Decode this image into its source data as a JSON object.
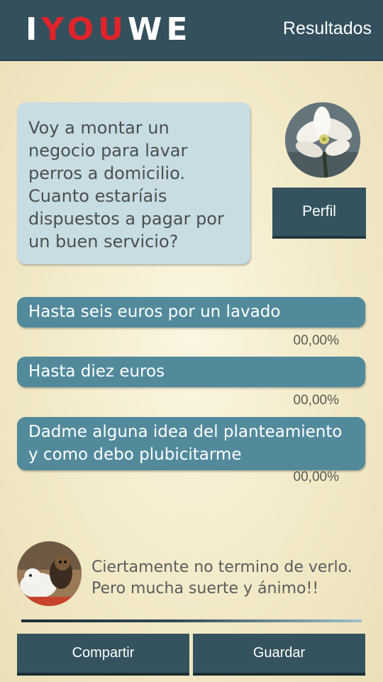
{
  "header": {
    "logo_part1": "I",
    "logo_part2": "YOU",
    "logo_part3": "WE",
    "results_label": "Resultados"
  },
  "question": {
    "text": "Voy a montar un negocio para lavar perros a domicilio. Cuanto estaríais dispuestos a pagar por un buen servicio?"
  },
  "profile": {
    "avatar_icon": "flower-avatar",
    "button_label": "Perfil"
  },
  "options": [
    {
      "label": "Hasta seis euros por un lavado",
      "percent": "00,00%"
    },
    {
      "label": "Hasta diez euros",
      "percent": "00,00%"
    },
    {
      "label": "Dadme alguna idea del planteamiento y como debo plubicitarme",
      "percent": "00,00%"
    }
  ],
  "comment": {
    "avatar_icon": "dogs-avatar",
    "text": "Ciertamente no termino de verlo. Pero mucha suerte y ánimo!!"
  },
  "actions": {
    "share_label": "Compartir",
    "save_label": "Guardar"
  },
  "colors": {
    "header": "#33505c",
    "bubble": "#c8dce3",
    "option": "#528a9c",
    "logo_accent": "#e0242b"
  }
}
